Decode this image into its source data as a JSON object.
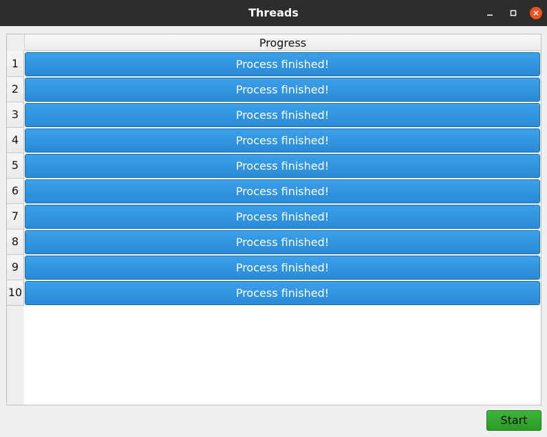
{
  "window": {
    "title": "Threads",
    "controls": {
      "minimize_icon": "minimize-icon",
      "maximize_icon": "maximize-icon",
      "close_icon": "close-icon"
    },
    "close_color": "#e95420"
  },
  "table": {
    "column_header": "Progress",
    "rows": [
      {
        "index": "1",
        "status": "Process finished!",
        "progress": 1.0
      },
      {
        "index": "2",
        "status": "Process finished!",
        "progress": 1.0
      },
      {
        "index": "3",
        "status": "Process finished!",
        "progress": 1.0
      },
      {
        "index": "4",
        "status": "Process finished!",
        "progress": 1.0
      },
      {
        "index": "5",
        "status": "Process finished!",
        "progress": 1.0
      },
      {
        "index": "6",
        "status": "Process finished!",
        "progress": 1.0
      },
      {
        "index": "7",
        "status": "Process finished!",
        "progress": 1.0
      },
      {
        "index": "8",
        "status": "Process finished!",
        "progress": 1.0
      },
      {
        "index": "9",
        "status": "Process finished!",
        "progress": 1.0
      },
      {
        "index": "10",
        "status": "Process finished!",
        "progress": 1.0
      }
    ],
    "progress_color": "#2f93e0"
  },
  "footer": {
    "start_label": "Start",
    "start_color": "#36a832"
  }
}
